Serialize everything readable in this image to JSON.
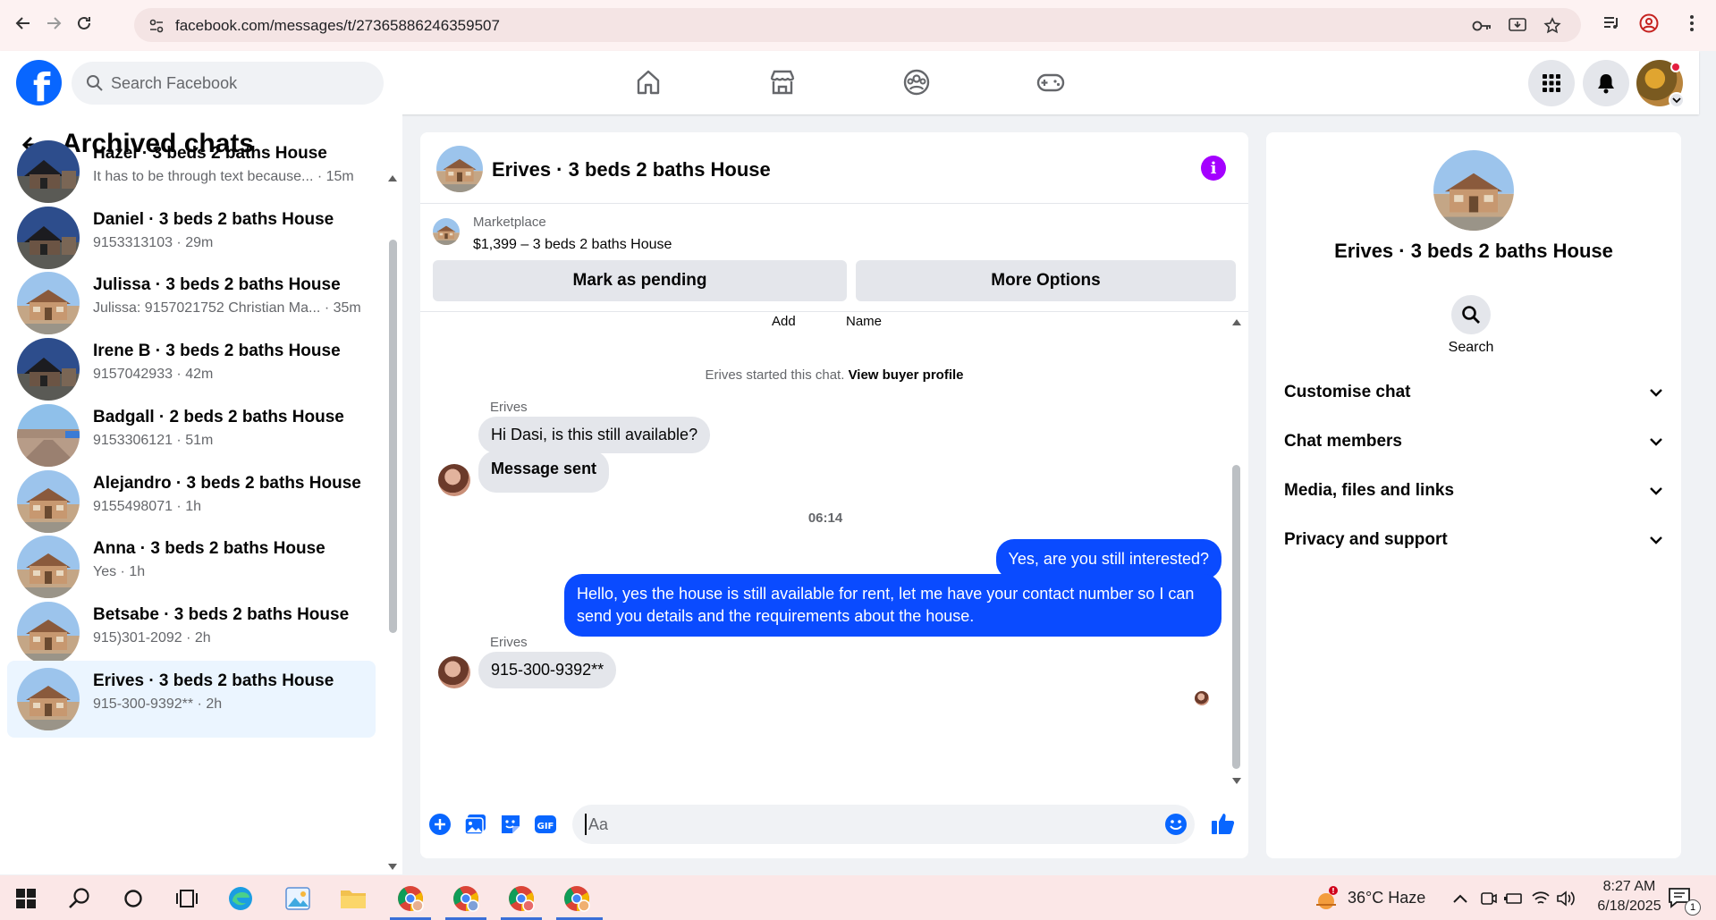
{
  "browser": {
    "url": "facebook.com/messages/t/27365886246359507"
  },
  "header": {
    "search_placeholder": "Search Facebook"
  },
  "left": {
    "title": "Archived chats",
    "chats": [
      {
        "name": "Hazel · 3 beds 2 baths House",
        "preview": "It has to be through text because... · 15m",
        "avatar": "dark-house"
      },
      {
        "name": "Daniel · 3 beds 2 baths House",
        "preview": "9153313103 · 29m",
        "avatar": "dark-house"
      },
      {
        "name": "Julissa · 3 beds 2 baths House",
        "preview": "Julissa: 9157021752 Christian Ma... · 35m",
        "avatar": "light-house"
      },
      {
        "name": "Irene B · 3 beds 2 baths House",
        "preview": "9157042933 · 42m",
        "avatar": "dark-house"
      },
      {
        "name": "Badgall · 2 beds 2 baths House",
        "preview": "9153306121 · 51m",
        "avatar": "street"
      },
      {
        "name": "Alejandro · 3 beds 2 baths House",
        "preview": "9155498071 · 1h",
        "avatar": "light-house"
      },
      {
        "name": "Anna · 3 beds 2 baths House",
        "preview": "Yes · 1h",
        "avatar": "light-house"
      },
      {
        "name": "Betsabe · 3 beds 2 baths House",
        "preview": "915)301-2092 · 2h",
        "avatar": "light-house"
      },
      {
        "name": "Erives · 3 beds 2 baths House",
        "preview": "915-300-9392** · 2h",
        "avatar": "light-house"
      }
    ]
  },
  "conversation": {
    "title": "Erives · 3 beds 2 baths House",
    "marketplace_label": "Marketplace",
    "listing": "$1,399 – 3 beds 2 baths House",
    "mark_pending": "Mark as pending",
    "more_options": "More Options",
    "add_label": "Add",
    "name_label": "Name",
    "started_text": "Erives started this chat.",
    "view_profile": "View buyer profile",
    "sender_name": "Erives",
    "msg1": "Hi Dasi, is this still available?",
    "msg2": "Message sent",
    "time_divider": "06:14",
    "out1": "Yes, are you still interested?",
    "out2": "Hello, yes the house is still available for rent, let me have your contact number so I can send you details and the requirements about the house.",
    "sender_name2": "Erives",
    "msg3": "915-300-9392**",
    "composer_placeholder": "Aa"
  },
  "right": {
    "title": "Erives · 3 beds 2 baths House",
    "search_label": "Search",
    "sections": [
      "Customise chat",
      "Chat members",
      "Media, files and links",
      "Privacy and support"
    ]
  },
  "taskbar": {
    "weather": "36°C  Haze",
    "time": "8:27 AM",
    "date": "6/18/2025",
    "notif_count": "1"
  },
  "colors": {
    "fb_blue": "#0866ff",
    "outgoing_bubble": "#0a4bff",
    "info_purple": "#a400ff"
  }
}
